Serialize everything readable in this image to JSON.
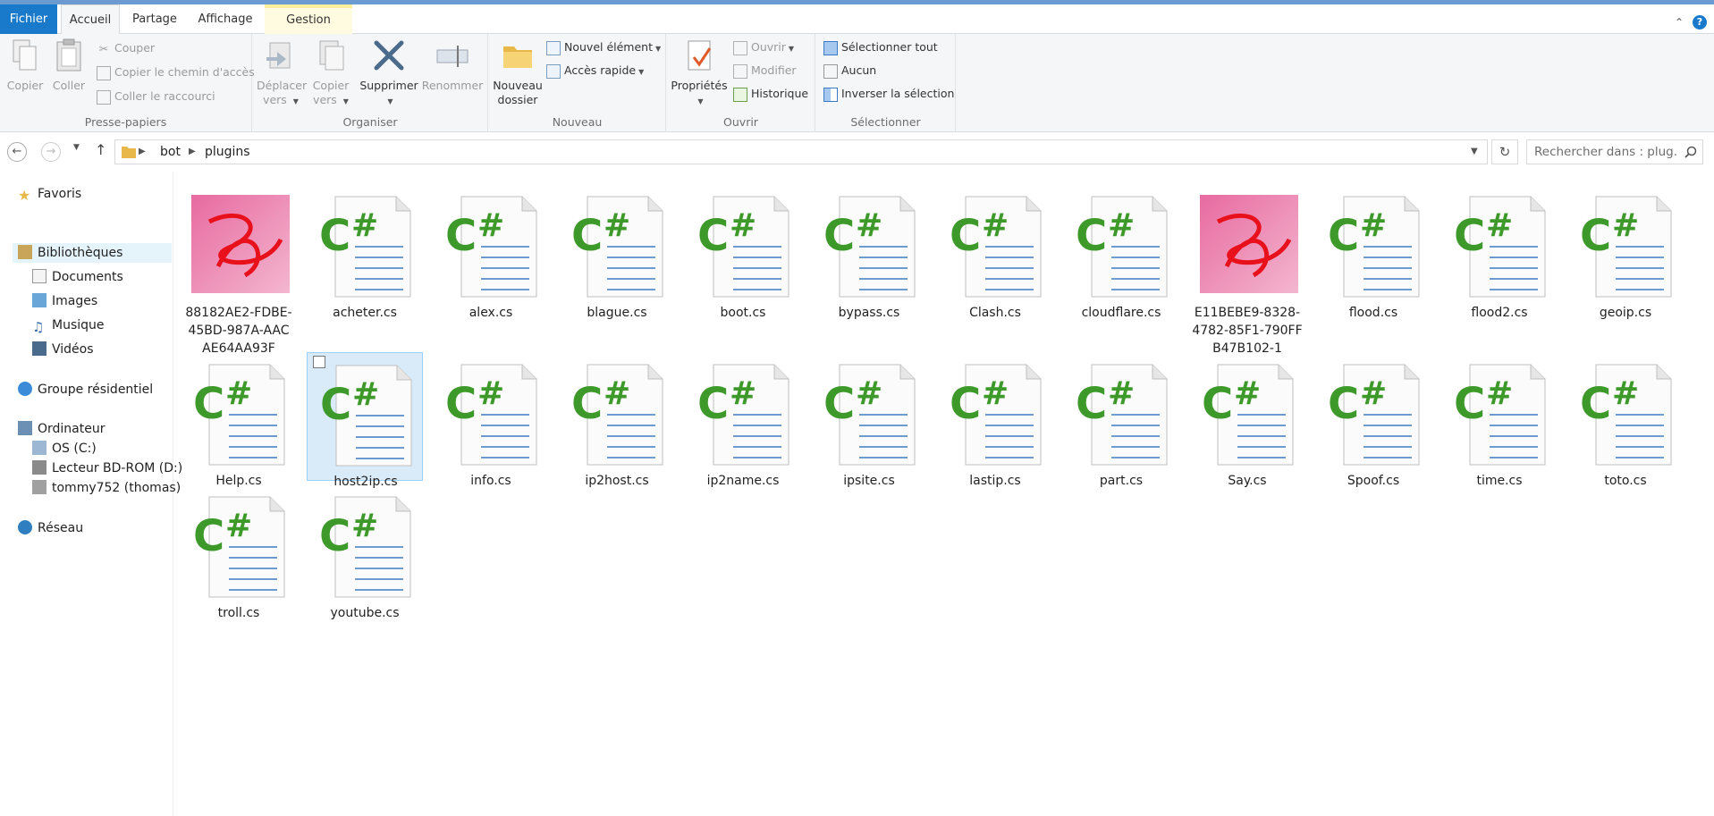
{
  "tabs": {
    "file": "Fichier",
    "home": "Accueil",
    "share": "Partage",
    "view": "Affichage",
    "manage": "Gestion"
  },
  "ribbon": {
    "clipboard": {
      "label": "Presse-papiers",
      "copy": "Copier",
      "paste": "Coller",
      "cut": "Couper",
      "copy_path": "Copier le chemin d'accès",
      "paste_shortcut": "Coller le raccourci"
    },
    "organize": {
      "label": "Organiser",
      "move_to_1": "Déplacer",
      "move_to_2": "vers",
      "copy_to_1": "Copier",
      "copy_to_2": "vers",
      "delete": "Supprimer",
      "rename": "Renommer"
    },
    "new": {
      "label": "Nouveau",
      "new_folder_1": "Nouveau",
      "new_folder_2": "dossier",
      "new_item": "Nouvel élément",
      "easy_access": "Accès rapide"
    },
    "open": {
      "label": "Ouvrir",
      "properties": "Propriétés",
      "open": "Ouvrir",
      "edit": "Modifier",
      "history": "Historique"
    },
    "select": {
      "label": "Sélectionner",
      "select_all": "Sélectionner tout",
      "select_none": "Aucun",
      "invert": "Inverser la sélection"
    }
  },
  "address": {
    "crumb1": "bot",
    "crumb2": "plugins",
    "search_placeholder": "Rechercher dans : plug..."
  },
  "sidebar": {
    "favorites": "Favoris",
    "libraries": "Bibliothèques",
    "documents": "Documents",
    "images": "Images",
    "music": "Musique",
    "videos": "Vidéos",
    "homegroup": "Groupe résidentiel",
    "computer": "Ordinateur",
    "drive_c": "OS (C:)",
    "drive_bd": "Lecteur BD-ROM (D:)",
    "user": "tommy752 (thomas)",
    "network": "Réseau"
  },
  "files": [
    {
      "name": "88182AE2-FDBE-45BD-987A-AAC AE64AA93F",
      "kind": "image"
    },
    {
      "name": "acheter.cs",
      "kind": "cs"
    },
    {
      "name": "alex.cs",
      "kind": "cs"
    },
    {
      "name": "blague.cs",
      "kind": "cs"
    },
    {
      "name": "boot.cs",
      "kind": "cs"
    },
    {
      "name": "bypass.cs",
      "kind": "cs"
    },
    {
      "name": "Clash.cs",
      "kind": "cs"
    },
    {
      "name": "cloudflare.cs",
      "kind": "cs"
    },
    {
      "name": "E11BEBE9-8328-4782-85F1-790FF B47B102-1",
      "kind": "image"
    },
    {
      "name": "flood.cs",
      "kind": "cs"
    },
    {
      "name": "flood2.cs",
      "kind": "cs"
    },
    {
      "name": "geoip.cs",
      "kind": "cs"
    },
    {
      "name": "Help.cs",
      "kind": "cs"
    },
    {
      "name": "host2ip.cs",
      "kind": "cs",
      "selected": true
    },
    {
      "name": "info.cs",
      "kind": "cs"
    },
    {
      "name": "ip2host.cs",
      "kind": "cs"
    },
    {
      "name": "ip2name.cs",
      "kind": "cs"
    },
    {
      "name": "ipsite.cs",
      "kind": "cs"
    },
    {
      "name": "lastip.cs",
      "kind": "cs"
    },
    {
      "name": "part.cs",
      "kind": "cs"
    },
    {
      "name": "Say.cs",
      "kind": "cs"
    },
    {
      "name": "Spoof.cs",
      "kind": "cs"
    },
    {
      "name": "time.cs",
      "kind": "cs"
    },
    {
      "name": "toto.cs",
      "kind": "cs"
    },
    {
      "name": "troll.cs",
      "kind": "cs"
    },
    {
      "name": "youtube.cs",
      "kind": "cs"
    }
  ],
  "colors": {
    "accent": "#1979ca",
    "csharp_green": "#3d9a2a",
    "scribble_red": "#e8101a",
    "selection_bg": "#d9ebf9"
  }
}
